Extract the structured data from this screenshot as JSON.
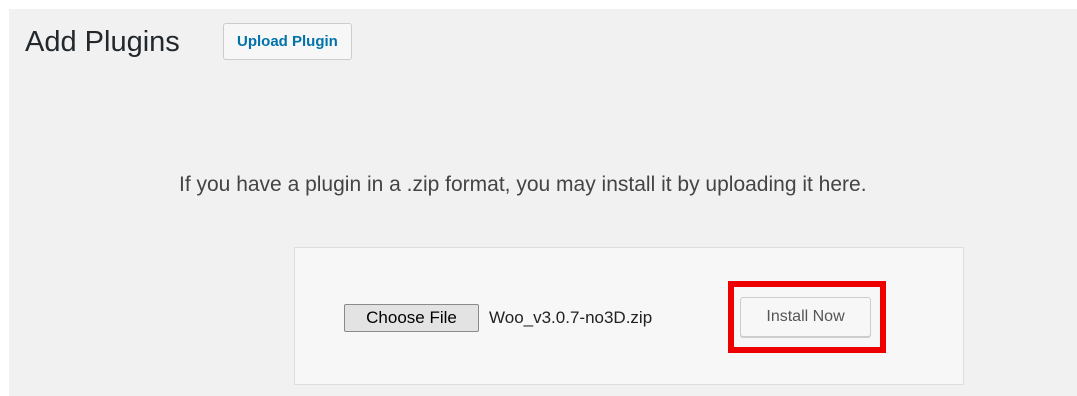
{
  "header": {
    "title": "Add Plugins",
    "upload_button_label": "Upload Plugin"
  },
  "upload": {
    "help_text": "If you have a plugin in a .zip format, you may install it by uploading it here.",
    "choose_file_label": "Choose File",
    "selected_file_name": "Woo_v3.0.7-no3D.zip",
    "install_button_label": "Install Now"
  },
  "colors": {
    "page_background": "#f1f1f1",
    "link_blue": "#0073aa",
    "highlight_red": "#ee0000"
  }
}
